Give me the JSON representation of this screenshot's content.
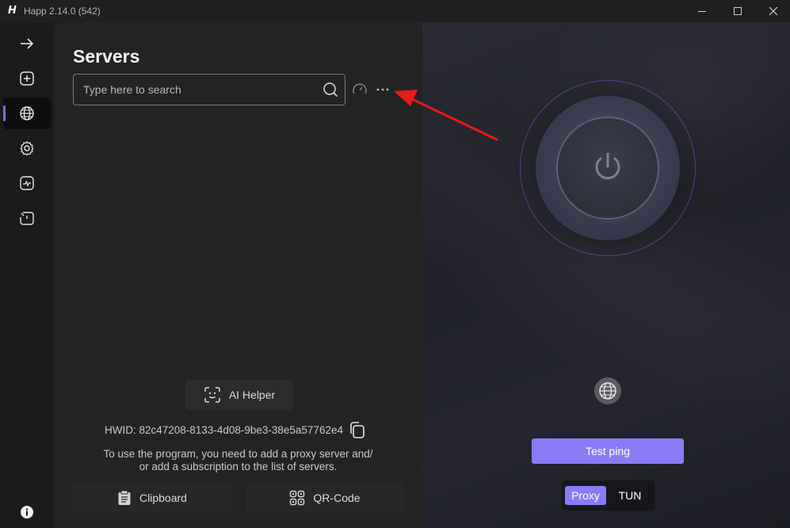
{
  "window": {
    "logo": "H",
    "title": "Happ 2.14.0 (542)"
  },
  "sidebar": {
    "items": [
      {
        "icon": "arrow-right-icon"
      },
      {
        "icon": "plus-square-icon"
      },
      {
        "icon": "globe-icon",
        "active": true
      },
      {
        "icon": "gear-icon"
      },
      {
        "icon": "activity-monitor-icon"
      },
      {
        "icon": "timer-icon"
      },
      {
        "icon": "info-icon"
      }
    ],
    "accent": "#7c6cf2"
  },
  "servers": {
    "title": "Servers",
    "search": {
      "placeholder": "Type here to search",
      "value": ""
    },
    "ai_helper_label": "AI Helper",
    "hwid_label": "HWID: 82c47208-8133-4d08-9be3-38e5a57762e4",
    "info_line1": "To use the program, you need to add a proxy server and/",
    "info_line2": "or add a subscription to the list of servers.",
    "clipboard_label": "Clipboard",
    "qrcode_label": "QR-Code"
  },
  "connect": {
    "test_ping_label": "Test ping",
    "mode_proxy_label": "Proxy",
    "mode_tun_label": "TUN",
    "selected_mode": "Proxy",
    "accent": "#8a7cf7"
  },
  "annotation": {
    "color": "#e8191c"
  }
}
